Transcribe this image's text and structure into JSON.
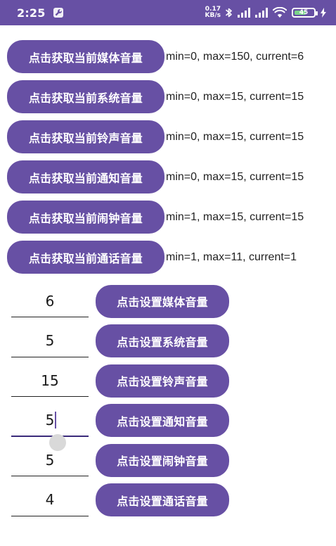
{
  "status_bar": {
    "time": "2:25",
    "net_speed_value": "0.17",
    "net_speed_unit": "KB/s",
    "battery_level": "45",
    "icons": [
      "wrench-icon",
      "bluetooth-icon",
      "signal-icon",
      "signal-icon",
      "wifi-icon",
      "battery-icon",
      "charging-icon"
    ]
  },
  "colors": {
    "accent": "#6750A4",
    "battery_fill": "#7bd389"
  },
  "get_rows": [
    {
      "button": "点击获取当前媒体音量",
      "info": "min=0, max=150, current=6"
    },
    {
      "button": "点击获取当前系统音量",
      "info": "min=0, max=15, current=15"
    },
    {
      "button": "点击获取当前铃声音量",
      "info": "min=0, max=15, current=15"
    },
    {
      "button": "点击获取当前通知音量",
      "info": "min=0, max=15, current=15"
    },
    {
      "button": "点击获取当前闹钟音量",
      "info": "min=1, max=15, current=15"
    },
    {
      "button": "点击获取当前通话音量",
      "info": "min=1, max=11, current=1"
    }
  ],
  "set_rows": [
    {
      "value": "6",
      "button": "点击设置媒体音量"
    },
    {
      "value": "5",
      "button": "点击设置系统音量"
    },
    {
      "value": "15",
      "button": "点击设置铃声音量"
    },
    {
      "value": "5",
      "button": "点击设置通知音量"
    },
    {
      "value": "5",
      "button": "点击设置闹钟音量"
    },
    {
      "value": "4",
      "button": "点击设置通话音量"
    }
  ]
}
